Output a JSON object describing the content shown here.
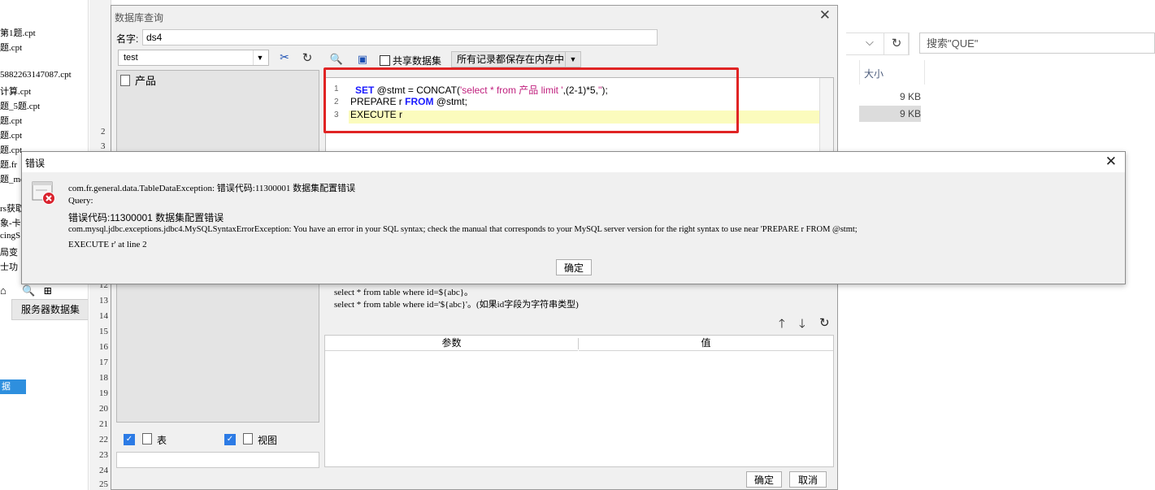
{
  "background_left": {
    "files": [
      "第1题.cpt",
      "题.cpt",
      "5882263147087.cpt",
      "计算.cpt",
      "题_5题.cpt",
      "题.cpt",
      "题.cpt",
      "题.cpt",
      "题.fr",
      "题_mo",
      "rs获取",
      "象-卡",
      "cingS",
      "局变",
      "士功"
    ],
    "server_dataset_tab": "服务器数据集",
    "selected_item": "据",
    "toolbar_label": "文"
  },
  "gutter_lines": [
    "2",
    "3",
    "12",
    "13",
    "14",
    "15",
    "16",
    "17",
    "18",
    "19",
    "20",
    "21",
    "22",
    "23",
    "24",
    "25"
  ],
  "background_right": {
    "search_placeholder": "搜索\"QUE\"",
    "size_header": "大小",
    "sizes": [
      "9 KB",
      "9 KB"
    ]
  },
  "main_dialog": {
    "title": "数据库查询",
    "name_label": "名字:",
    "name_value": "ds4",
    "connection": "test",
    "tree_node": "产品",
    "share_dataset_label": "共享数据集",
    "memory_option": "所有记录都保存在内存中",
    "code_lines": [
      {
        "num": "1"
      },
      {
        "num": "2"
      },
      {
        "num": "3"
      }
    ],
    "sql": {
      "l1_kw1": "SET",
      "l1_a": " @stmt = CONCAT(",
      "l1_str1": "'select * from 产品 limit '",
      "l1_b": ",(2-1)*5,",
      "l1_str2": "''",
      "l1_c": ");",
      "l2_a": "PREPARE r ",
      "l2_kw": "FROM",
      "l2_b": " @stmt;",
      "l3": "EXECUTE r"
    },
    "hint_line1": "select * from table where id=${abc}。",
    "hint_line2": "select * from table where id='${abc}'。(如果id字段为字符串类型)",
    "param_header": "参数",
    "value_header": "值",
    "table_label": "表",
    "view_label": "视图",
    "ok_label": "确定",
    "cancel_label": "取消"
  },
  "error_dialog": {
    "title": "错误",
    "line1": "com.fr.general.data.TableDataException: 错误代码:11300001 数据集配置错误",
    "line2": "Query:",
    "line3": "错误代码:11300001 数据集配置错误",
    "line4": "com.mysql.jdbc.exceptions.jdbc4.MySQLSyntaxErrorException: You have an error in your SQL syntax; check the manual that corresponds to your MySQL server version for the right syntax to use near 'PREPARE r FROM @stmt;",
    "line5": "EXECUTE r' at line 2",
    "ok_label": "确定"
  },
  "colors": {
    "highlight_box": "#e02424",
    "keyword": "#1a1aff",
    "string": "#c0207e",
    "current_line": "#fbfbbd",
    "checkbox": "#2c7be5",
    "error_icon": "#d9232e"
  }
}
